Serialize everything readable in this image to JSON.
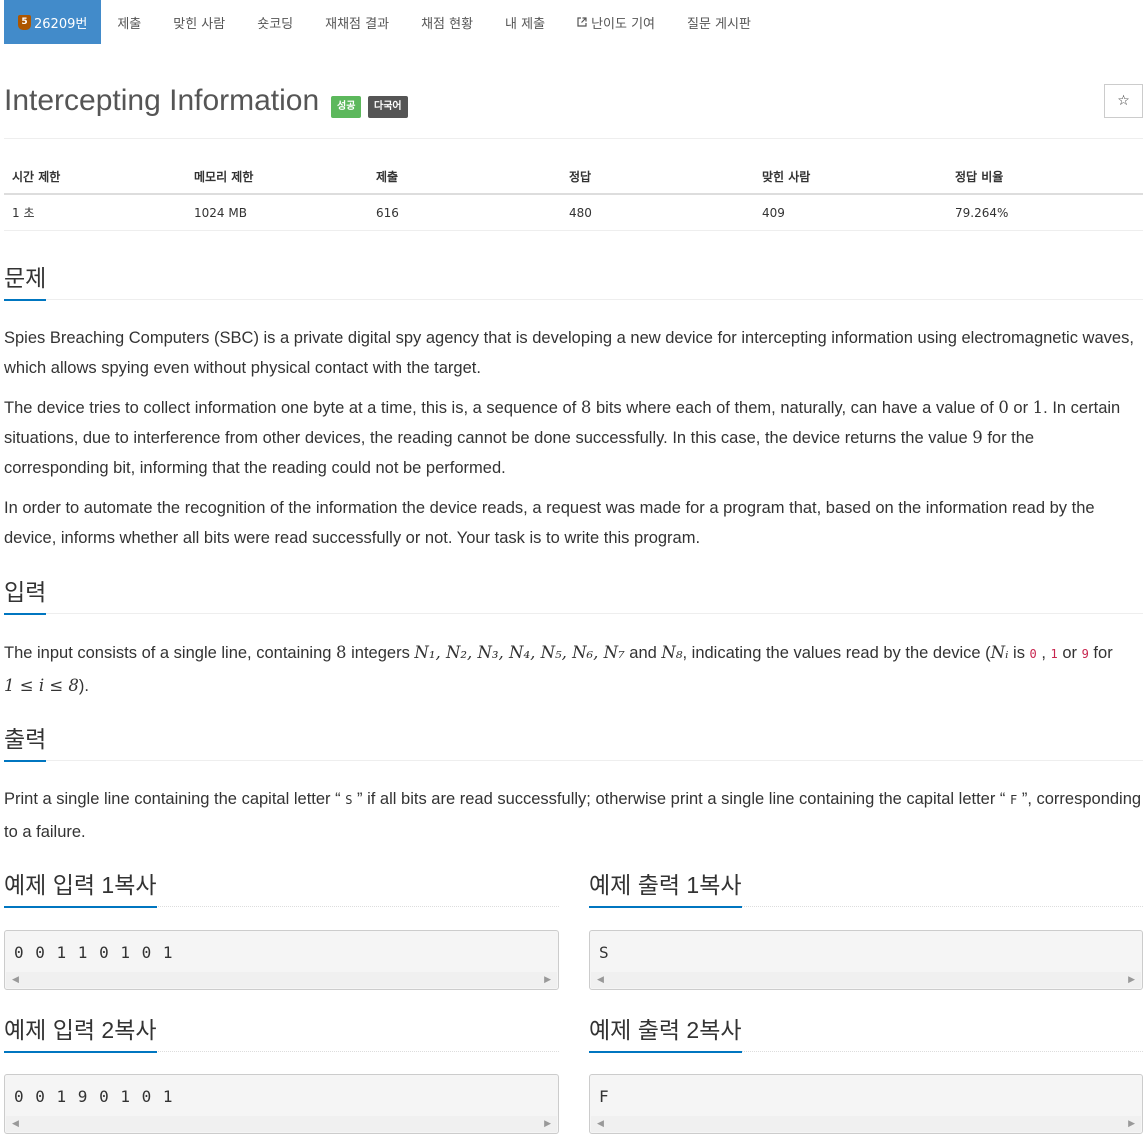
{
  "nav": {
    "problem_id": "26209번",
    "tier": "5",
    "items": [
      "제출",
      "맞힌 사람",
      "숏코딩",
      "재채점 결과",
      "채점 현황",
      "내 제출",
      "난이도 기여",
      "질문 게시판"
    ]
  },
  "problem": {
    "title": "Intercepting Information",
    "labels": [
      "성공",
      "다국어"
    ],
    "star": "☆"
  },
  "info": {
    "headers": [
      "시간 제한",
      "메모리 제한",
      "제출",
      "정답",
      "맞힌 사람",
      "정답 비율"
    ],
    "values": [
      "1 초",
      "1024 MB",
      "616",
      "480",
      "409",
      "79.264%"
    ]
  },
  "sections": {
    "problem": "문제",
    "input": "입력",
    "output": "출력"
  },
  "statement": {
    "p1": "Spies Breaching Computers (SBC) is a private digital spy agency that is developing a new device for intercepting information using electromagnetic waves, which allows spying even without physical contact with the target.",
    "p2a": "The device tries to collect information one byte at a time, this is, a sequence of ",
    "p2_n8": "8",
    "p2b": " bits where each of them, naturally, can have a value of ",
    "p2_0": "0",
    "p2c": " or ",
    "p2_1": "1",
    "p2d": ". In certain situations, due to interference from other devices, the reading cannot be done successfully. In this case, the device returns the value ",
    "p2_9": "9",
    "p2e": " for the corresponding bit, informing that the reading could not be performed.",
    "p3": "In order to automate the recognition of the information the device reads, a request was made for a program that, based on the information read by the device, informs whether all bits were read successfully or not. Your task is to write this program."
  },
  "input_text": {
    "a": "The input consists of a single line, containing ",
    "n8": "8",
    "b": " integers ",
    "vars": "N₁, N₂, N₃, N₄, N₅, N₆, N₇",
    "and": " and ",
    "n8var": "N₈",
    "c": ", indicating the values read by the device (",
    "ni": "Nᵢ",
    "is": " is ",
    "v0": "0",
    "comma": " , ",
    "v1": "1",
    "or": " or ",
    "v9": "9",
    "for": " for",
    "range": "1 ≤ i ≤ 8",
    "end": ")."
  },
  "output_text": {
    "a": "Print a single line containing the capital letter “ ",
    "s": "S",
    "b": " ” if all bits are read successfully; otherwise print a single line containing the capital letter “ ",
    "f": "F",
    "c": " ”, corresponding to a failure."
  },
  "samples": {
    "copy": "복사",
    "in1_title": "예제 입력 1",
    "out1_title": "예제 출력 1",
    "in2_title": "예제 입력 2",
    "out2_title": "예제 출력 2",
    "in1": "0 0 1 1 0 1 0 1",
    "out1": "S",
    "in2": "0 0 1 9 0 1 0 1",
    "out2": "F"
  }
}
